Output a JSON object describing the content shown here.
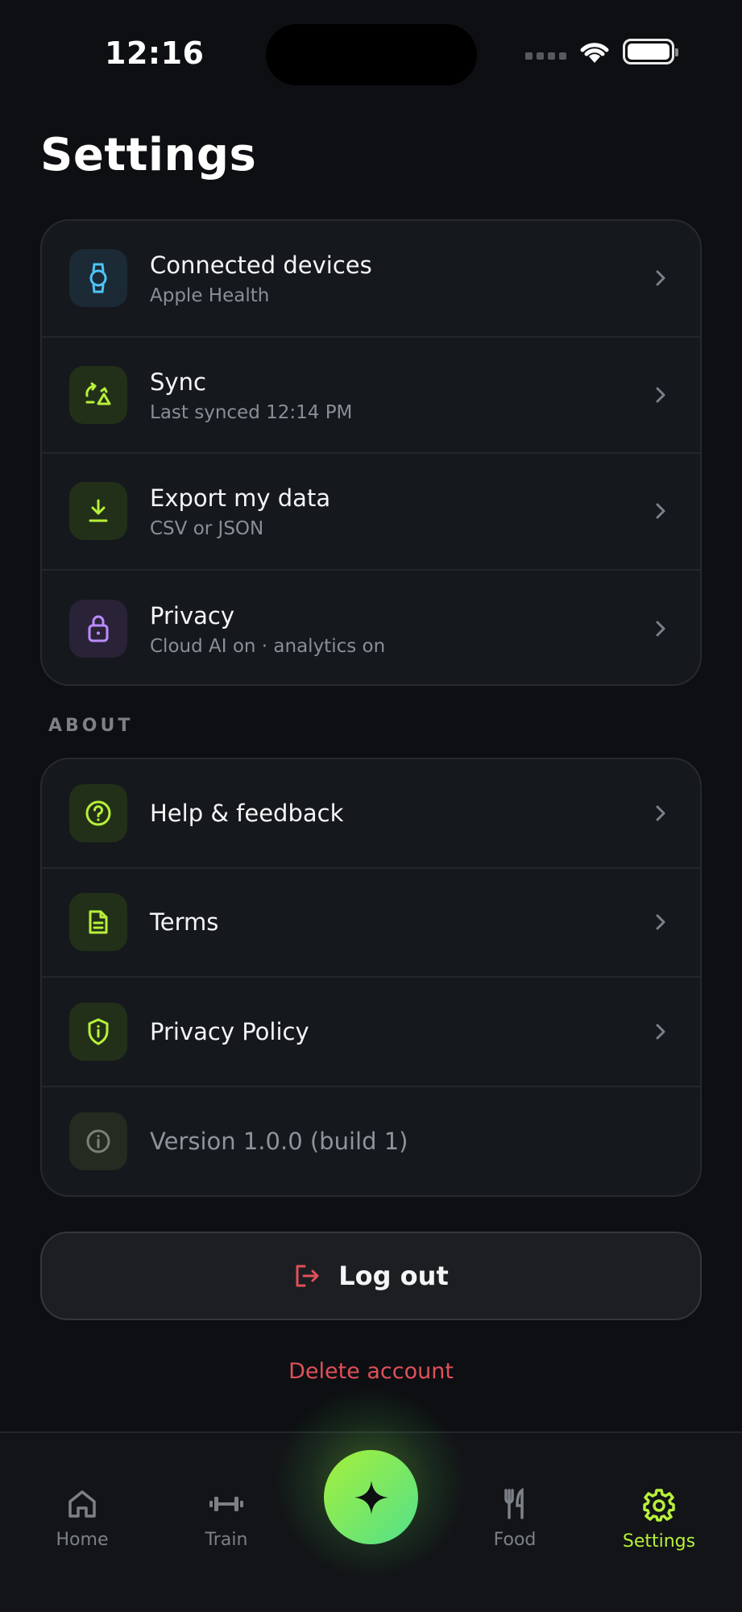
{
  "status_bar": {
    "time": "12:16"
  },
  "page": {
    "title": "Settings"
  },
  "account_section": {
    "items": [
      {
        "title": "Connected devices",
        "subtitle": "Apple Health",
        "icon": "watch-icon",
        "accent": "#4fc3f7"
      },
      {
        "title": "Sync",
        "subtitle": "Last synced 12:14 PM",
        "icon": "sync-icon",
        "accent": "#b7f03a"
      },
      {
        "title": "Export my data",
        "subtitle": "CSV or JSON",
        "icon": "download-icon",
        "accent": "#b7f03a"
      },
      {
        "title": "Privacy",
        "subtitle": "Cloud AI on · analytics on",
        "icon": "lock-icon",
        "accent": "#b98cff"
      }
    ]
  },
  "about_section": {
    "label": "ABOUT",
    "items": [
      {
        "title": "Help & feedback",
        "icon": "help-circle-icon"
      },
      {
        "title": "Terms",
        "icon": "document-icon"
      },
      {
        "title": "Privacy Policy",
        "icon": "shield-icon"
      },
      {
        "title": "Version 1.0.0 (build 1)",
        "icon": "info-icon"
      }
    ]
  },
  "actions": {
    "logout_label": "Log out",
    "delete_label": "Delete account"
  },
  "tabbar": {
    "tabs": [
      {
        "label": "Home",
        "icon": "home-icon"
      },
      {
        "label": "Train",
        "icon": "dumbbell-icon"
      },
      {
        "label": "Food",
        "icon": "fork-knife-icon"
      },
      {
        "label": "Settings",
        "icon": "gear-icon",
        "active": true
      }
    ],
    "center_action_icon": "sparkle-icon"
  },
  "colors": {
    "accent": "#b7f03a",
    "danger": "#e0505a",
    "background": "#0d0f12"
  }
}
